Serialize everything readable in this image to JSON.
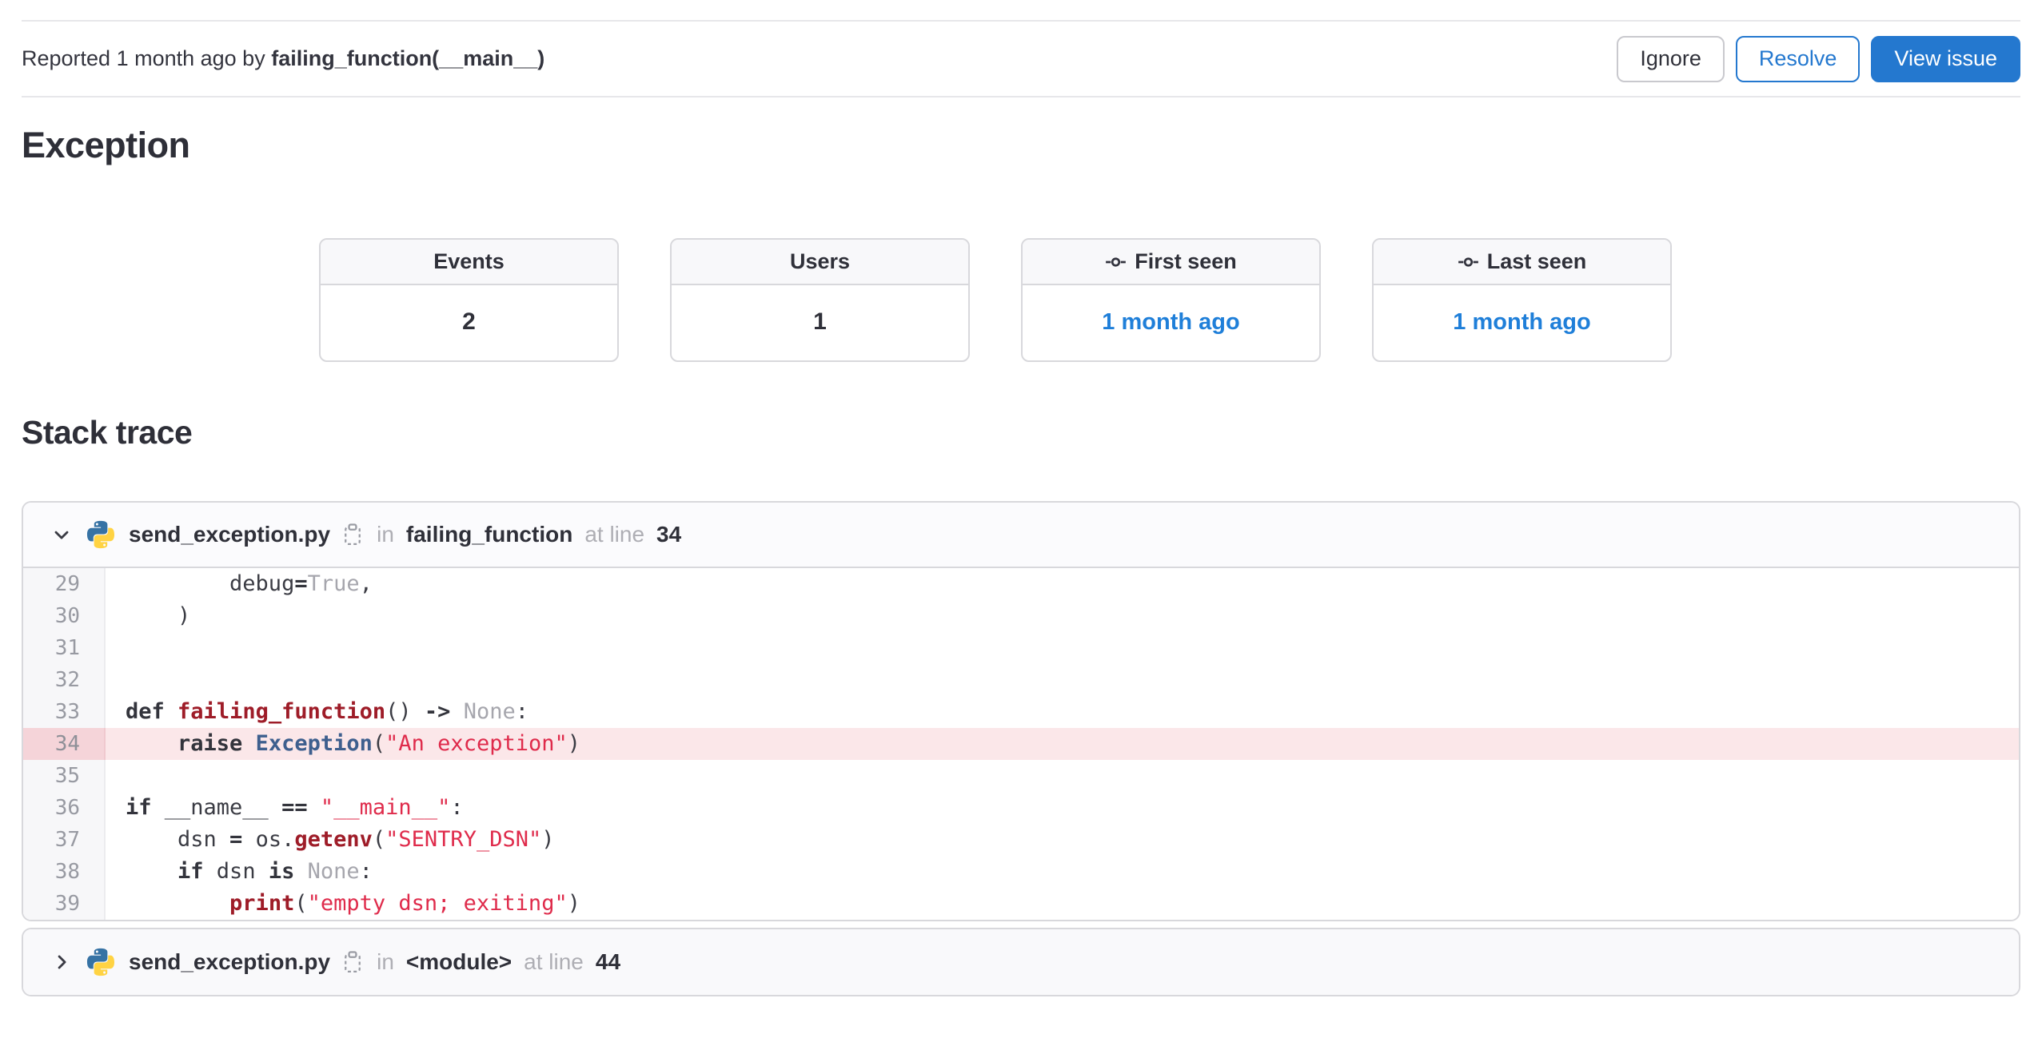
{
  "colors": {
    "accent_blue": "#2478cf",
    "link_blue": "#1f7fd9",
    "string_red": "#df2b4b",
    "function_red": "#9e1c28",
    "exception_blue": "#3e5f8e",
    "literal_gray": "#a6a6ad",
    "highlight_bg": "#fbe7e9",
    "highlight_gutter": "#f5d4d9",
    "python_blue": "#3672a4",
    "python_yellow": "#ffd343"
  },
  "report_bar": {
    "prefix": "Reported 1 month ago by ",
    "reporter": "failing_function(__main__)",
    "buttons": {
      "ignore": "Ignore",
      "resolve": "Resolve",
      "view_issue": "View issue"
    }
  },
  "exception_title": "Exception",
  "stats": [
    {
      "label": "Events",
      "value": "2",
      "icon": null,
      "is_link": false
    },
    {
      "label": "Users",
      "value": "1",
      "icon": null,
      "is_link": false
    },
    {
      "label": "First seen",
      "value": "1 month ago",
      "icon": "commit-icon",
      "is_link": true
    },
    {
      "label": "Last seen",
      "value": "1 month ago",
      "icon": "commit-icon",
      "is_link": true
    }
  ],
  "stack_trace": {
    "title": "Stack trace",
    "frames": [
      {
        "collapsed": false,
        "icon": "python-icon",
        "chevron": "chevron-down-icon",
        "filename": "send_exception.py",
        "copy_icon": "copy-icon",
        "in_label": "in",
        "function": "failing_function",
        "at_label": "at line",
        "line": "34",
        "lines": [
          {
            "no": "29",
            "hl": false,
            "tokens": [
              {
                "c": "tp",
                "t": "        debug"
              },
              {
                "c": "to",
                "t": "="
              },
              {
                "c": "tl",
                "t": "True"
              },
              {
                "c": "tp",
                "t": ","
              }
            ]
          },
          {
            "no": "30",
            "hl": false,
            "tokens": [
              {
                "c": "tp",
                "t": "    )"
              }
            ]
          },
          {
            "no": "31",
            "hl": false,
            "tokens": []
          },
          {
            "no": "32",
            "hl": false,
            "tokens": []
          },
          {
            "no": "33",
            "hl": false,
            "tokens": [
              {
                "c": "tk",
                "t": "def"
              },
              {
                "c": "tp",
                "t": " "
              },
              {
                "c": "tf",
                "t": "failing_function"
              },
              {
                "c": "tp",
                "t": "() "
              },
              {
                "c": "to",
                "t": "->"
              },
              {
                "c": "tp",
                "t": " "
              },
              {
                "c": "tl",
                "t": "None"
              },
              {
                "c": "tp",
                "t": ":"
              }
            ]
          },
          {
            "no": "34",
            "hl": true,
            "tokens": [
              {
                "c": "tp",
                "t": "    "
              },
              {
                "c": "tk",
                "t": "raise"
              },
              {
                "c": "tp",
                "t": " "
              },
              {
                "c": "te",
                "t": "Exception"
              },
              {
                "c": "tp",
                "t": "("
              },
              {
                "c": "ts",
                "t": "\"An exception\""
              },
              {
                "c": "tp",
                "t": ")"
              }
            ]
          },
          {
            "no": "35",
            "hl": false,
            "tokens": []
          },
          {
            "no": "36",
            "hl": false,
            "tokens": [
              {
                "c": "tk",
                "t": "if"
              },
              {
                "c": "tp",
                "t": " __name__ "
              },
              {
                "c": "to",
                "t": "=="
              },
              {
                "c": "tp",
                "t": " "
              },
              {
                "c": "ts",
                "t": "\"__main__\""
              },
              {
                "c": "tp",
                "t": ":"
              }
            ]
          },
          {
            "no": "37",
            "hl": false,
            "tokens": [
              {
                "c": "tp",
                "t": "    dsn "
              },
              {
                "c": "to",
                "t": "="
              },
              {
                "c": "tp",
                "t": " os."
              },
              {
                "c": "tf",
                "t": "getenv"
              },
              {
                "c": "tp",
                "t": "("
              },
              {
                "c": "ts",
                "t": "\"SENTRY_DSN\""
              },
              {
                "c": "tp",
                "t": ")"
              }
            ]
          },
          {
            "no": "38",
            "hl": false,
            "tokens": [
              {
                "c": "tp",
                "t": "    "
              },
              {
                "c": "tk",
                "t": "if"
              },
              {
                "c": "tp",
                "t": " dsn "
              },
              {
                "c": "to",
                "t": "is"
              },
              {
                "c": "tp",
                "t": " "
              },
              {
                "c": "tl",
                "t": "None"
              },
              {
                "c": "tp",
                "t": ":"
              }
            ]
          },
          {
            "no": "39",
            "hl": false,
            "tokens": [
              {
                "c": "tp",
                "t": "        "
              },
              {
                "c": "tf",
                "t": "print"
              },
              {
                "c": "tp",
                "t": "("
              },
              {
                "c": "ts",
                "t": "\"empty dsn; exiting\""
              },
              {
                "c": "tp",
                "t": ")"
              }
            ]
          }
        ]
      },
      {
        "collapsed": true,
        "icon": "python-icon",
        "chevron": "chevron-right-icon",
        "filename": "send_exception.py",
        "copy_icon": "copy-icon",
        "in_label": "in",
        "function": "<module>",
        "at_label": "at line",
        "line": "44"
      }
    ]
  }
}
